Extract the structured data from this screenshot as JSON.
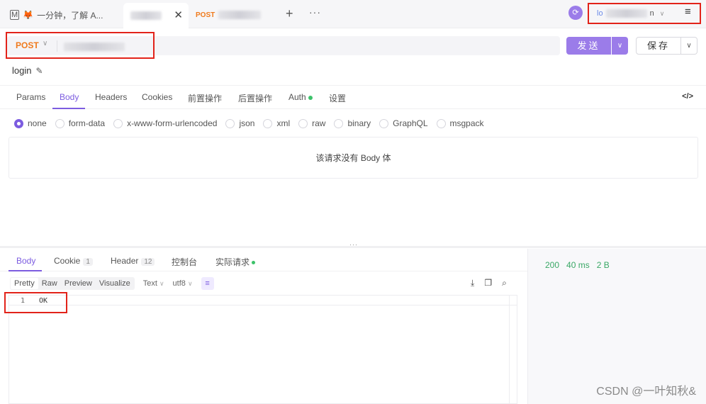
{
  "tabs": [
    {
      "label": "一分钟，了解 A...",
      "icon": "markdown-icon"
    },
    {
      "label": ""
    },
    {
      "label": "POST",
      "method_color": "#f07a1c"
    }
  ],
  "toolbar_right": {
    "env_label": "lo",
    "env_suffix": "n"
  },
  "request": {
    "method": "POST",
    "send_label": "发送",
    "save_label": "保存",
    "name": "login"
  },
  "request_tabs": [
    "Params",
    "Body",
    "Headers",
    "Cookies",
    "前置操作",
    "后置操作",
    "Auth",
    "设置"
  ],
  "body_types": [
    "none",
    "form-data",
    "x-www-form-urlencoded",
    "json",
    "xml",
    "raw",
    "binary",
    "GraphQL",
    "msgpack"
  ],
  "body_empty_text": "该请求没有 Body 体",
  "response": {
    "tabs": {
      "body": "Body",
      "cookie": "Cookie",
      "cookie_count": "1",
      "header": "Header",
      "header_count": "12",
      "console": "控制台",
      "actual": "实际请求"
    },
    "view_modes": [
      "Pretty",
      "Raw",
      "Preview",
      "Visualize"
    ],
    "format": "Text",
    "encoding": "utf8",
    "line_number": "1",
    "line_content": "OK"
  },
  "status": {
    "code": "200",
    "time": "40 ms",
    "size": "2 B"
  },
  "watermark": "CSDN @一叶知秋&",
  "colors": {
    "accent": "#7c5ce0",
    "method": "#f07a1c",
    "success": "#3aa866",
    "highlight_box": "#e2231a"
  }
}
